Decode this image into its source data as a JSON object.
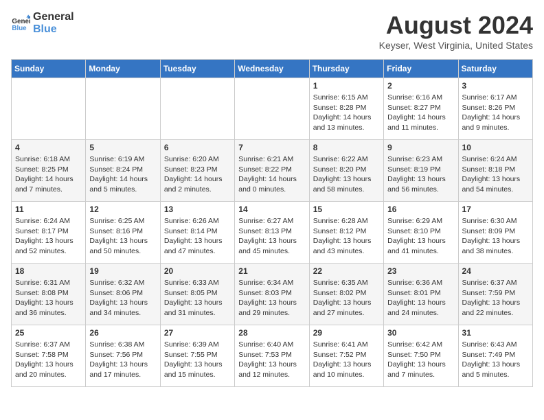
{
  "logo": {
    "line1": "General",
    "line2": "Blue"
  },
  "title": "August 2024",
  "location": "Keyser, West Virginia, United States",
  "days_of_week": [
    "Sunday",
    "Monday",
    "Tuesday",
    "Wednesday",
    "Thursday",
    "Friday",
    "Saturday"
  ],
  "weeks": [
    [
      {
        "num": "",
        "info": ""
      },
      {
        "num": "",
        "info": ""
      },
      {
        "num": "",
        "info": ""
      },
      {
        "num": "",
        "info": ""
      },
      {
        "num": "1",
        "info": "Sunrise: 6:15 AM\nSunset: 8:28 PM\nDaylight: 14 hours\nand 13 minutes."
      },
      {
        "num": "2",
        "info": "Sunrise: 6:16 AM\nSunset: 8:27 PM\nDaylight: 14 hours\nand 11 minutes."
      },
      {
        "num": "3",
        "info": "Sunrise: 6:17 AM\nSunset: 8:26 PM\nDaylight: 14 hours\nand 9 minutes."
      }
    ],
    [
      {
        "num": "4",
        "info": "Sunrise: 6:18 AM\nSunset: 8:25 PM\nDaylight: 14 hours\nand 7 minutes."
      },
      {
        "num": "5",
        "info": "Sunrise: 6:19 AM\nSunset: 8:24 PM\nDaylight: 14 hours\nand 5 minutes."
      },
      {
        "num": "6",
        "info": "Sunrise: 6:20 AM\nSunset: 8:23 PM\nDaylight: 14 hours\nand 2 minutes."
      },
      {
        "num": "7",
        "info": "Sunrise: 6:21 AM\nSunset: 8:22 PM\nDaylight: 14 hours\nand 0 minutes."
      },
      {
        "num": "8",
        "info": "Sunrise: 6:22 AM\nSunset: 8:20 PM\nDaylight: 13 hours\nand 58 minutes."
      },
      {
        "num": "9",
        "info": "Sunrise: 6:23 AM\nSunset: 8:19 PM\nDaylight: 13 hours\nand 56 minutes."
      },
      {
        "num": "10",
        "info": "Sunrise: 6:24 AM\nSunset: 8:18 PM\nDaylight: 13 hours\nand 54 minutes."
      }
    ],
    [
      {
        "num": "11",
        "info": "Sunrise: 6:24 AM\nSunset: 8:17 PM\nDaylight: 13 hours\nand 52 minutes."
      },
      {
        "num": "12",
        "info": "Sunrise: 6:25 AM\nSunset: 8:16 PM\nDaylight: 13 hours\nand 50 minutes."
      },
      {
        "num": "13",
        "info": "Sunrise: 6:26 AM\nSunset: 8:14 PM\nDaylight: 13 hours\nand 47 minutes."
      },
      {
        "num": "14",
        "info": "Sunrise: 6:27 AM\nSunset: 8:13 PM\nDaylight: 13 hours\nand 45 minutes."
      },
      {
        "num": "15",
        "info": "Sunrise: 6:28 AM\nSunset: 8:12 PM\nDaylight: 13 hours\nand 43 minutes."
      },
      {
        "num": "16",
        "info": "Sunrise: 6:29 AM\nSunset: 8:10 PM\nDaylight: 13 hours\nand 41 minutes."
      },
      {
        "num": "17",
        "info": "Sunrise: 6:30 AM\nSunset: 8:09 PM\nDaylight: 13 hours\nand 38 minutes."
      }
    ],
    [
      {
        "num": "18",
        "info": "Sunrise: 6:31 AM\nSunset: 8:08 PM\nDaylight: 13 hours\nand 36 minutes."
      },
      {
        "num": "19",
        "info": "Sunrise: 6:32 AM\nSunset: 8:06 PM\nDaylight: 13 hours\nand 34 minutes."
      },
      {
        "num": "20",
        "info": "Sunrise: 6:33 AM\nSunset: 8:05 PM\nDaylight: 13 hours\nand 31 minutes."
      },
      {
        "num": "21",
        "info": "Sunrise: 6:34 AM\nSunset: 8:03 PM\nDaylight: 13 hours\nand 29 minutes."
      },
      {
        "num": "22",
        "info": "Sunrise: 6:35 AM\nSunset: 8:02 PM\nDaylight: 13 hours\nand 27 minutes."
      },
      {
        "num": "23",
        "info": "Sunrise: 6:36 AM\nSunset: 8:01 PM\nDaylight: 13 hours\nand 24 minutes."
      },
      {
        "num": "24",
        "info": "Sunrise: 6:37 AM\nSunset: 7:59 PM\nDaylight: 13 hours\nand 22 minutes."
      }
    ],
    [
      {
        "num": "25",
        "info": "Sunrise: 6:37 AM\nSunset: 7:58 PM\nDaylight: 13 hours\nand 20 minutes."
      },
      {
        "num": "26",
        "info": "Sunrise: 6:38 AM\nSunset: 7:56 PM\nDaylight: 13 hours\nand 17 minutes."
      },
      {
        "num": "27",
        "info": "Sunrise: 6:39 AM\nSunset: 7:55 PM\nDaylight: 13 hours\nand 15 minutes."
      },
      {
        "num": "28",
        "info": "Sunrise: 6:40 AM\nSunset: 7:53 PM\nDaylight: 13 hours\nand 12 minutes."
      },
      {
        "num": "29",
        "info": "Sunrise: 6:41 AM\nSunset: 7:52 PM\nDaylight: 13 hours\nand 10 minutes."
      },
      {
        "num": "30",
        "info": "Sunrise: 6:42 AM\nSunset: 7:50 PM\nDaylight: 13 hours\nand 7 minutes."
      },
      {
        "num": "31",
        "info": "Sunrise: 6:43 AM\nSunset: 7:49 PM\nDaylight: 13 hours\nand 5 minutes."
      }
    ]
  ]
}
